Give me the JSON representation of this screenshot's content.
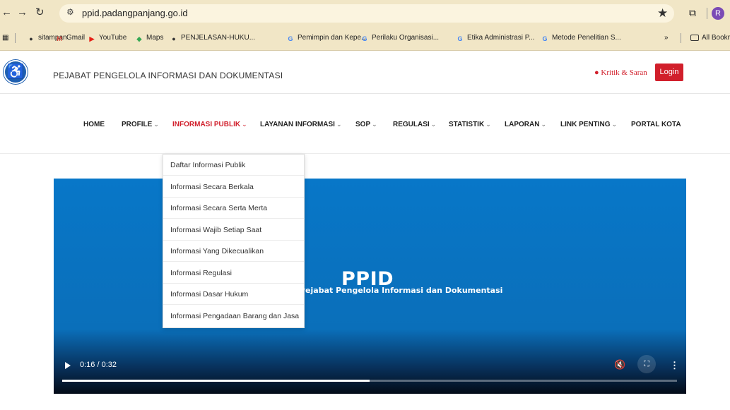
{
  "browser": {
    "url": "ppid.padangpanjang.go.id",
    "profile_initial": "R",
    "bookmarks": [
      {
        "label": "sitampan",
        "icon": "globe-icon",
        "color": "#333333"
      },
      {
        "label": "Gmail",
        "icon": "gmail-icon",
        "color": "#d44638"
      },
      {
        "label": "YouTube",
        "icon": "youtube-icon",
        "color": "#e62117"
      },
      {
        "label": "Maps",
        "icon": "maps-icon",
        "color": "#34a853"
      },
      {
        "label": "PENJELASAN-HUKU...",
        "icon": "globe-icon",
        "color": "#333333"
      },
      {
        "label": "Pemimpin dan Kepe...",
        "icon": "google-icon",
        "color": "#4285f4"
      },
      {
        "label": "Perilaku Organisasi...",
        "icon": "google-icon",
        "color": "#4285f4"
      },
      {
        "label": "Etika Administrasi P...",
        "icon": "google-icon",
        "color": "#4285f4"
      },
      {
        "label": "Metode Penelitian S...",
        "icon": "google-icon",
        "color": "#4285f4"
      }
    ],
    "more_bookmarks": "»",
    "all_bookmarks": "All Bookm"
  },
  "header": {
    "site_title": "PEJABAT PENGELOLA INFORMASI DAN DOKUMENTASI",
    "kritik_label": "Kritik & Saran",
    "login_label": "Login"
  },
  "nav": {
    "items": [
      {
        "label": "HOME",
        "has_dropdown": false
      },
      {
        "label": "PROFILE",
        "has_dropdown": true
      },
      {
        "label": "INFORMASI PUBLIK",
        "has_dropdown": true,
        "active": true
      },
      {
        "label": "LAYANAN INFORMASI",
        "has_dropdown": true
      },
      {
        "label": "SOP",
        "has_dropdown": true
      },
      {
        "label": "REGULASI",
        "has_dropdown": true
      },
      {
        "label": "STATISTIK",
        "has_dropdown": true
      },
      {
        "label": "LAPORAN",
        "has_dropdown": true
      },
      {
        "label": "LINK PENTING",
        "has_dropdown": true
      },
      {
        "label": "PORTAL KOTA",
        "has_dropdown": false
      }
    ],
    "dropdown_items": [
      "Daftar Informasi Publik",
      "Informasi Secara Berkala",
      "Informasi Secara Serta Merta",
      "Informasi Wajib Setiap Saat",
      "Informasi Yang Dikecualikan",
      "Informasi Regulasi",
      "Informasi Dasar Hukum",
      "Informasi Pengadaan Barang dan Jasa"
    ]
  },
  "video": {
    "title": "PPID",
    "subtitle": "Pejabat Pengelola Informasi dan Dokumentasi",
    "time": "0:16 / 0:32",
    "progress": 0.5
  },
  "colors": {
    "accent": "#d11f2b",
    "video_blue": "#0877c8"
  }
}
